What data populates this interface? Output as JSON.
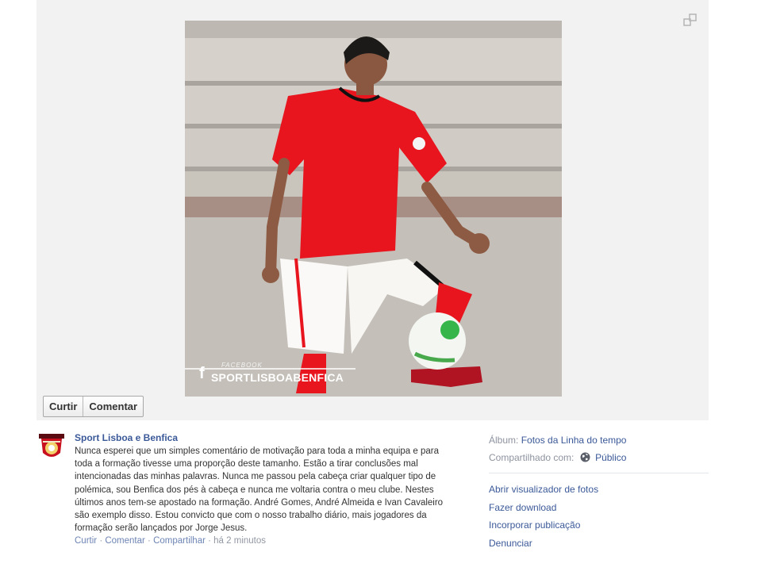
{
  "actions": {
    "like": "Curtir",
    "comment": "Comentar"
  },
  "photo": {
    "watermark_small": "FACEBOOK",
    "watermark_brand": "SPORTLISBOABENFICA",
    "watermark_f": "f"
  },
  "post": {
    "page_name": "Sport Lisboa e Benfica",
    "caption": "Nunca esperei que um simples comentário de motivação para toda a minha equipa e para toda a formação tivesse uma proporção deste tamanho. Estão a tirar conclusões mal intencionadas das minhas palavras. Nunca me passou pela cabeça criar qualquer tipo de polémica, sou Benfica dos pés à cabeça e nunca me voltaria contra o meu clube. Nestes últimos anos tem-se apostado na formação. André Gomes, André Almeida e Ivan Cavaleiro são exemplo disso. Estou convicto que com o nosso trabalho diário, mais jogadores da formação serão lançados por Jorge Jesus.",
    "action_like": "Curtir",
    "action_comment": "Comentar",
    "action_share": "Compartilhar",
    "timestamp": "há 2 minutos",
    "dot": " · "
  },
  "side": {
    "album_label": "Álbum:",
    "album_value": "Fotos da Linha do tempo",
    "shared_label": "Compartilhado com:",
    "shared_value": "Público",
    "links": [
      "Abrir visualizador de fotos",
      "Fazer download",
      "Incorporar publicação",
      "Denunciar"
    ]
  },
  "colors": {
    "link": "#3b5998",
    "jersey": "#e8141e",
    "stage": "#f2f2f2"
  }
}
